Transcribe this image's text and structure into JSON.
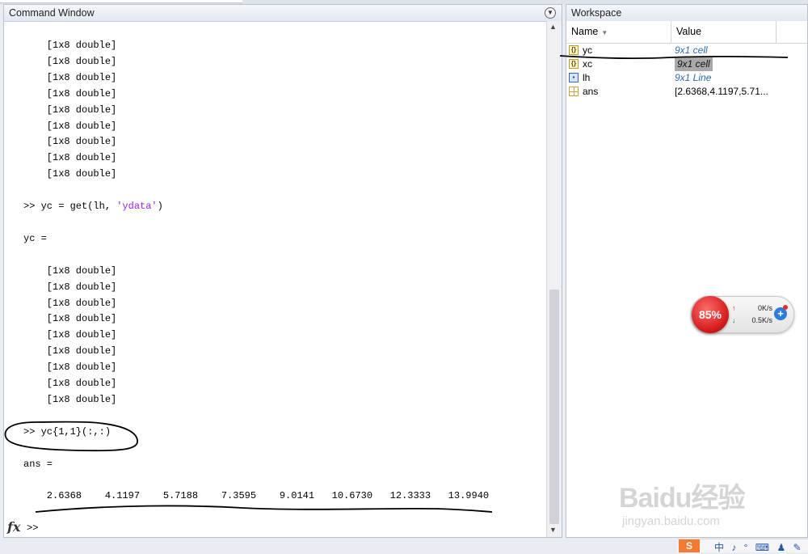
{
  "command_window": {
    "title": "Command Window",
    "lines_1": [
      "    [1x8 double]",
      "    [1x8 double]",
      "    [1x8 double]",
      "    [1x8 double]",
      "    [1x8 double]",
      "    [1x8 double]",
      "    [1x8 double]",
      "    [1x8 double]",
      "    [1x8 double]"
    ],
    "cmd1_prefix": ">> yc = get(lh, ",
    "cmd1_string": "'ydata'",
    "cmd1_suffix": ")",
    "result1_label": "yc =",
    "lines_2": [
      "    [1x8 double]",
      "    [1x8 double]",
      "    [1x8 double]",
      "    [1x8 double]",
      "    [1x8 double]",
      "    [1x8 double]",
      "    [1x8 double]",
      "    [1x8 double]",
      "    [1x8 double]"
    ],
    "cmd2": ">> yc{1,1}(:,:)",
    "result2_label": "ans =",
    "ans_values": "    2.6368    4.1197    5.7188    7.3595    9.0141   10.6730   12.3333   13.9940",
    "prompt": ">>"
  },
  "workspace": {
    "title": "Workspace",
    "col_name": "Name",
    "col_value": "Value",
    "rows": [
      {
        "name": "yc",
        "value": "9x1 cell",
        "icon": "cell-icon"
      },
      {
        "name": "xc",
        "value": "9x1 cell",
        "icon": "cell-icon"
      },
      {
        "name": "lh",
        "value": "9x1 Line",
        "icon": "line-object-icon"
      },
      {
        "name": "ans",
        "value": "[2.6368,4.1197,5.71...",
        "icon": "matrix-icon"
      }
    ]
  },
  "net_widget": {
    "percent": "85%",
    "up_rate": "0K/s",
    "down_rate": "0.5K/s"
  },
  "watermark": {
    "main": "Baidu经验",
    "sub": "jingyan.baidu.com"
  },
  "tray": {
    "sogou": "S",
    "glyphs": "中 ♪ ° ⌨ ♟ ✎"
  },
  "colors": {
    "string": "#a020f0",
    "link": "#2c6bb3",
    "widget_red": "#d01717"
  }
}
